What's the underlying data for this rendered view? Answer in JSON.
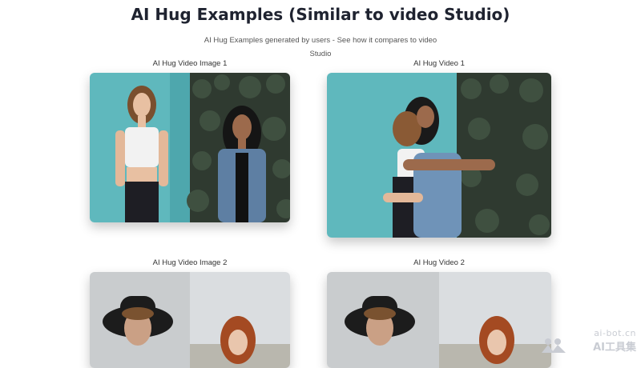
{
  "page": {
    "title": "AI Hug Examples (Similar to video Studio)",
    "subtitle": "AI Hug Examples generated by users - See how it compares to video Studio"
  },
  "examples": [
    {
      "image_caption": "AI Hug Video Image 1",
      "video_caption": "AI Hug Video 1"
    },
    {
      "image_caption": "AI Hug Video Image 2",
      "video_caption": "AI Hug Video 2"
    }
  ],
  "watermark": {
    "line1": "ai-bot.cn",
    "line2": "AI工具集"
  },
  "colors": {
    "teal_wall": "#5fb8bd",
    "ivy": "#2f3a30",
    "grey_wall": "#c9ccce",
    "sky": "#dadde0"
  }
}
